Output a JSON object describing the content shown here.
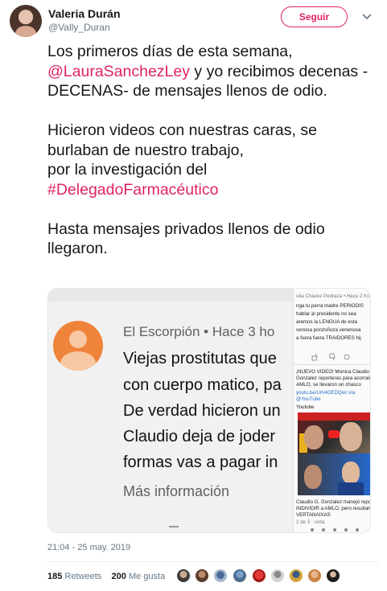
{
  "author": {
    "name": "Valeria Durán",
    "handle": "@Vally_Duran"
  },
  "follow_button": "Seguir",
  "tweet": {
    "p1_a": "Los primeros días de esta semana, ",
    "p1_mention": "@LauraSanchezLey",
    "p1_b": " y yo recibimos decenas -DECENAS- de mensajes llenos de odio.",
    "p2_a": "Hicieron videos con nuestras caras, se burlaban de nuestro trabajo,",
    "p2_b": "por la investigación del ",
    "p2_hashtag": "#DelegadoFarmacéutico",
    "p3": "Hasta mensajes privados llenos de odio llegaron."
  },
  "media": {
    "left": {
      "author": "El Escorpión",
      "time": "• Hace 3 ho",
      "lines": [
        "Viejas prostitutas que",
        "con cuerpo matico, pa",
        "De verdad hicieron un",
        "Claudio deja de joder",
        "formas vas a pagar in"
      ],
      "more_info": "Más información"
    },
    "right": {
      "header": "ulia Chávez Pedraza  • Hace 2 ho",
      "comment": [
        "nga tu perra madre PERIODIS",
        "hablar al presidente no sea",
        "aremos la LENGUA de esta",
        "venosa ponzoñoza venenosa",
        "a fuera fuera TRAIDORES hij"
      ],
      "yt1": [
        "¡NUEVO VIDEO! Monica Claudio A.",
        "Gonzalez reporteras para acorralar a",
        "AMLO, se llevaron un chasco"
      ],
      "yt1_link": "youtu.be/Um4OEDQeo vía",
      "yt1_source": "@YouTube",
      "yt1_label": "Youtube",
      "yt2": [
        "Claudio G. Gonzalez manejó reporteras para",
        "INDIVIDIR a AMLO, pero resultaron",
        "VERTANAIXAS"
      ],
      "yt2_meta": "2 de 3 · vista"
    }
  },
  "timestamp": "21:04 - 25 may. 2019",
  "stats": {
    "retweets_count": "185",
    "retweets_label": "Retweets",
    "likes_count": "200",
    "likes_label": "Me gusta"
  },
  "colors": {
    "accent": "#e0245e",
    "muted": "#657786"
  }
}
